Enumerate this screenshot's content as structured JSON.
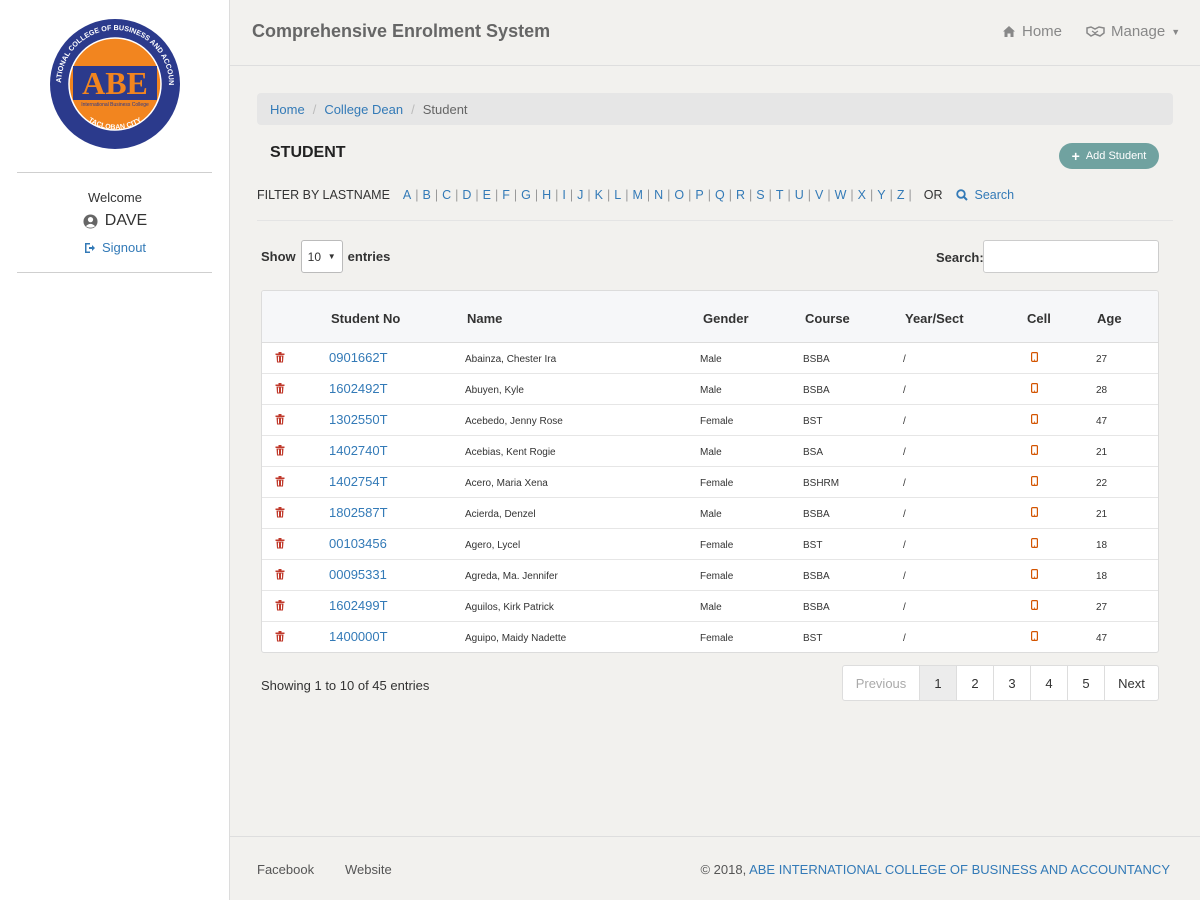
{
  "app": {
    "title": "Comprehensive Enrolment System"
  },
  "nav": {
    "home": "Home",
    "manage": "Manage"
  },
  "sidebar": {
    "logo": {
      "ring_text": "INTERNATIONAL COLLEGE OF BUSINESS AND ACCOUNTANCY",
      "city": "TACLOBAN CITY",
      "mark": "ABE",
      "tagline": "International Business College"
    },
    "welcome": "Welcome",
    "user": "DAVE",
    "signout": "Signout"
  },
  "breadcrumb": [
    "Home",
    "College Dean",
    "Student"
  ],
  "page": {
    "title": "STUDENT",
    "add_button": "Add Student"
  },
  "filter": {
    "label": "FILTER BY LASTNAME",
    "letters": [
      "A",
      "B",
      "C",
      "D",
      "E",
      "F",
      "G",
      "H",
      "I",
      "J",
      "K",
      "L",
      "M",
      "N",
      "O",
      "P",
      "Q",
      "R",
      "S",
      "T",
      "U",
      "V",
      "W",
      "X",
      "Y",
      "Z"
    ],
    "or": "OR",
    "search": "Search"
  },
  "table_controls": {
    "show": "Show",
    "length": "10",
    "entries": "entries",
    "search_label": "Search:"
  },
  "table": {
    "headers": [
      "Student No",
      "Name",
      "Gender",
      "Course",
      "Year/Sect",
      "Cell",
      "Age"
    ],
    "rows": [
      {
        "sno": "0901662T",
        "name": "Abainza, Chester Ira",
        "gender": "Male",
        "course": "BSBA",
        "year": "/",
        "age": "27"
      },
      {
        "sno": "1602492T",
        "name": "Abuyen, Kyle",
        "gender": "Male",
        "course": "BSBA",
        "year": "/",
        "age": "28"
      },
      {
        "sno": "1302550T",
        "name": "Acebedo, Jenny Rose",
        "gender": "Female",
        "course": "BST",
        "year": "/",
        "age": "47"
      },
      {
        "sno": "1402740T",
        "name": "Acebias, Kent Rogie",
        "gender": "Male",
        "course": "BSA",
        "year": "/",
        "age": "21"
      },
      {
        "sno": "1402754T",
        "name": "Acero, Maria Xena",
        "gender": "Female",
        "course": "BSHRM",
        "year": "/",
        "age": "22"
      },
      {
        "sno": "1802587T",
        "name": "Acierda, Denzel",
        "gender": "Male",
        "course": "BSBA",
        "year": "/",
        "age": "21"
      },
      {
        "sno": "00103456",
        "name": "Agero, Lycel",
        "gender": "Female",
        "course": "BST",
        "year": "/",
        "age": "18"
      },
      {
        "sno": "00095331",
        "name": "Agreda, Ma. Jennifer",
        "gender": "Female",
        "course": "BSBA",
        "year": "/",
        "age": "18"
      },
      {
        "sno": "1602499T",
        "name": "Aguilos, Kirk Patrick",
        "gender": "Male",
        "course": "BSBA",
        "year": "/",
        "age": "27"
      },
      {
        "sno": "1400000T",
        "name": "Aguipo, Maidy Nadette",
        "gender": "Female",
        "course": "BST",
        "year": "/",
        "age": "47"
      }
    ]
  },
  "info": "Showing 1 to 10 of 45 entries",
  "pager": [
    "Previous",
    "1",
    "2",
    "3",
    "4",
    "5",
    "Next"
  ],
  "pager_active": "1",
  "footer": {
    "facebook": "Facebook",
    "website": "Website",
    "copy_prefix": "© 2018, ",
    "copy_link": "ABE INTERNATIONAL COLLEGE OF BUSINESS AND ACCOUNTANCY"
  },
  "colors": {
    "link": "#337ab7",
    "trash": "#c0392b",
    "phone": "#d35400",
    "add_button": "#70a2a0",
    "logo_ring": "#2b3a8c",
    "logo_fill": "#f2851f"
  }
}
